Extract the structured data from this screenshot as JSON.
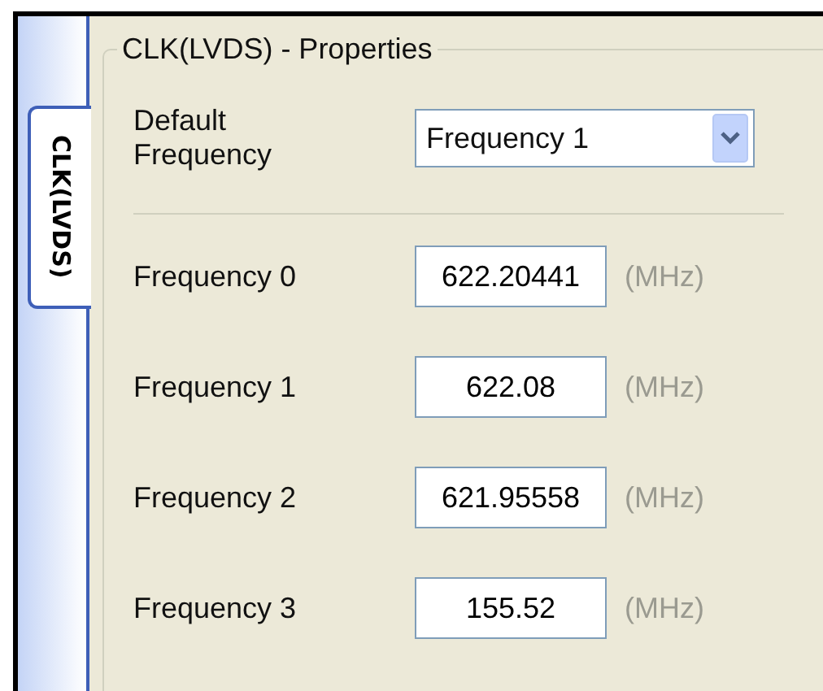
{
  "tabs": [
    {
      "label": "CLK(LVDS)",
      "selected": true
    }
  ],
  "group": {
    "title": "CLK(LVDS) - Properties",
    "default_frequency": {
      "label": "Default\nFrequency",
      "value": "Frequency 1"
    },
    "frequencies": [
      {
        "label": "Frequency 0",
        "value": "622.20441",
        "unit": "(MHz)"
      },
      {
        "label": "Frequency 1",
        "value": "622.08",
        "unit": "(MHz)"
      },
      {
        "label": "Frequency 2",
        "value": "621.95558",
        "unit": "(MHz)"
      },
      {
        "label": "Frequency 3",
        "value": "155.52",
        "unit": "(MHz)"
      }
    ]
  }
}
